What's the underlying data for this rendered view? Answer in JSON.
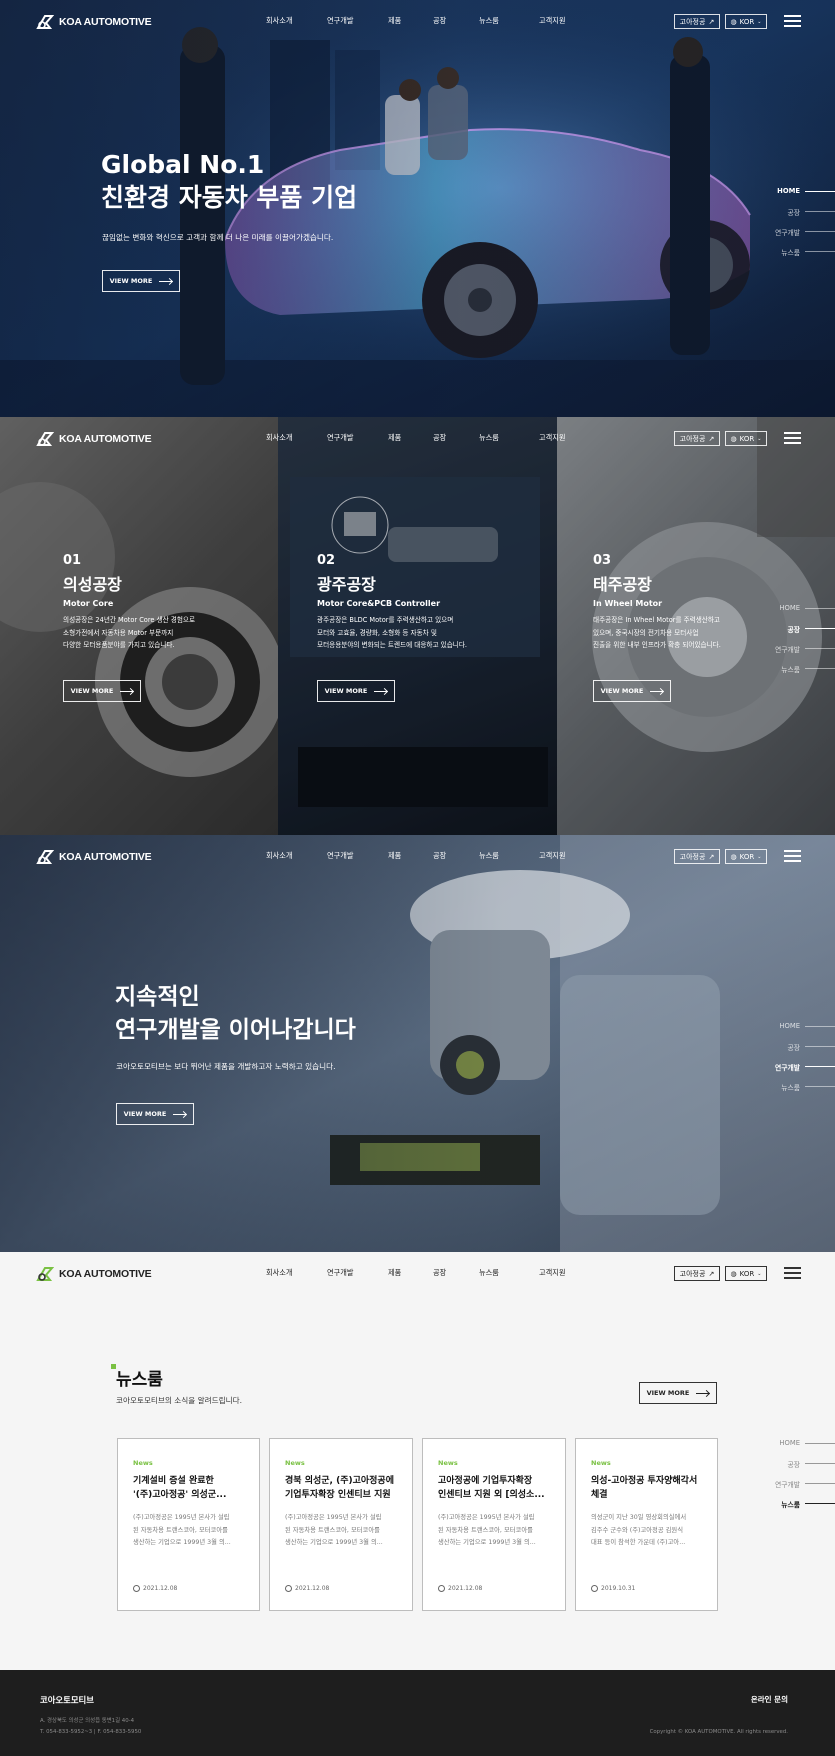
{
  "header": {
    "logo_text": "KOA AUTOMOTIVE",
    "nav": [
      "회사소개",
      "연구개발",
      "제품",
      "공장",
      "뉴스룸",
      "고객지원"
    ],
    "partner_btn": "고아정공",
    "lang_btn": "KOR"
  },
  "sidenav": [
    "HOME",
    "공장",
    "연구개발",
    "뉴스룸"
  ],
  "hero": {
    "title_line1": "Global No.1",
    "title_line2": "친환경 자동차 부품 기업",
    "subtitle": "끊임없는 변화와 혁신으로 고객과 함께 더 나은 미래를 이끌어가겠습니다.",
    "button": "VIEW MORE"
  },
  "factories": [
    {
      "num": "01",
      "name": "의성공장",
      "product": "Motor Core",
      "desc": [
        "의성공장은 24년간 Motor Core 생산 경험으로",
        "소형가전에서 자동차용 Motor 부문까지",
        "다양한 모터용품분야를 가지고 있습니다."
      ],
      "button": "VIEW MORE"
    },
    {
      "num": "02",
      "name": "광주공장",
      "product": "Motor Core&PCB Controller",
      "desc": [
        "광주공장은 BLDC Motor를 주력생산하고 있으며",
        "모터와 고효율, 경량화, 소형화 등 자동차 및",
        "모터응용분야의 변화되는 트렌드에 대응하고 있습니다."
      ],
      "button": "VIEW MORE"
    },
    {
      "num": "03",
      "name": "태주공장",
      "product": "In Wheel Motor",
      "desc": [
        "태주공장은 In Wheel Motor를 주력생산하고",
        "있으며, 중국시장의 전기차용 모터사업",
        "진출을 위한 내부 인프라가 확충 되어있습니다."
      ],
      "button": "VIEW MORE"
    }
  ],
  "rnd": {
    "title_line1": "지속적인",
    "title_line2": "연구개발을 이어나갑니다",
    "subtitle": "코아오토모티브는 보다 뛰어난 제품을 개발하고자 노력하고 있습니다.",
    "button": "VIEW MORE"
  },
  "news": {
    "title": "뉴스룸",
    "subtitle": "코아오토모티브의 소식을 알려드립니다.",
    "button": "VIEW MORE",
    "cards": [
      {
        "tag": "News",
        "title": [
          "기계설비 증설 완료한",
          "'(주)고아정공' 의성군..."
        ],
        "body": [
          "(주)고아정공은 1995년 본사가 설립",
          "된 자동차용 트랜스코아, 모터코아를",
          "생산하는 기업으로 1999년 3월 의..."
        ],
        "date": "2021.12.08"
      },
      {
        "tag": "News",
        "title": [
          "경북 의성군, (주)고아정공에",
          "기업투자확장 인센티브 지원"
        ],
        "body": [
          "(주)고아정공은 1995년 본사가 설립",
          "된 자동차용 트랜스코아, 모터코아를",
          "생산하는 기업으로 1999년 3월 의..."
        ],
        "date": "2021.12.08"
      },
      {
        "tag": "News",
        "title": [
          "고아정공에 기업투자확장",
          "인센티브 지원 외 [의성소..."
        ],
        "body": [
          "(주)고아정공은 1995년 본사가 설립",
          "된 자동차용 트랜스코아, 모터코아를",
          "생산하는 기업으로 1999년 3월 의..."
        ],
        "date": "2021.12.08"
      },
      {
        "tag": "News",
        "title": [
          "의성-고아정공 투자양해각서",
          "체결"
        ],
        "body": [
          "의성군이 지난 30일 영상회의실에서",
          "김주수 군수와 (주)고아정공 김원식",
          "대표 등이 참석한 가운데 (주)고아..."
        ],
        "date": "2019.10.31"
      }
    ]
  },
  "footer": {
    "company": "코아오토모티브",
    "address": "A. 경상북도 의성군 의성읍 동변1길 40-4",
    "contact": "T. 054-833-5952~3  |  F. 054-833-5950",
    "inquiry": "온라인 문의",
    "copyright": "Copyright © KOA AUTOMOTIVE. All rights reserved."
  },
  "colors": {
    "accent_green": "#7ac143",
    "footer_bg": "#1e1e1e",
    "news_bg": "#f5f5f5"
  }
}
